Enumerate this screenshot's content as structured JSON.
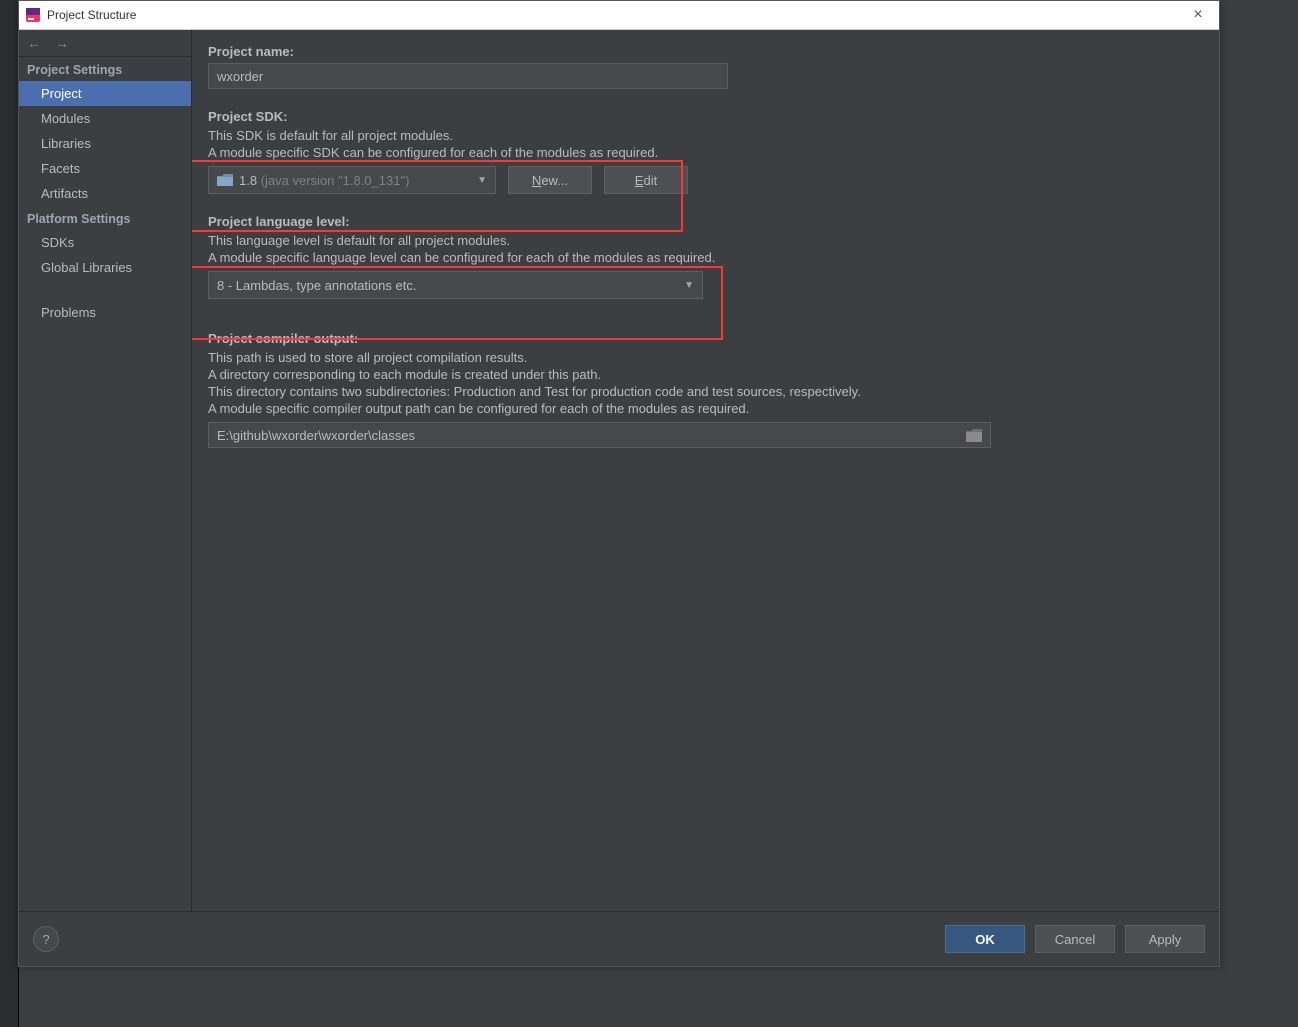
{
  "window": {
    "title": "Project Structure"
  },
  "sidebar": {
    "section1": "Project Settings",
    "items1": [
      "Project",
      "Modules",
      "Libraries",
      "Facets",
      "Artifacts"
    ],
    "section2": "Platform Settings",
    "items2": [
      "SDKs",
      "Global Libraries"
    ],
    "problems": "Problems"
  },
  "project_name": {
    "label": "Project name:",
    "value": "wxorder"
  },
  "project_sdk": {
    "label": "Project SDK:",
    "desc1": "This SDK is default for all project modules.",
    "desc2": "A module specific SDK can be configured for each of the modules as required.",
    "value_main": "1.8",
    "value_dim": "(java version \"1.8.0_131\")",
    "new_btn": "New...",
    "new_mnemonic": "N",
    "edit_btn": "Edit",
    "edit_mnemonic": "E"
  },
  "lang_level": {
    "label": "Project language level:",
    "desc1": "This language level is default for all project modules.",
    "desc2": "A module specific language level can be configured for each of the modules as required.",
    "value": "8 - Lambdas, type annotations etc."
  },
  "compiler_output": {
    "label": "Project compiler output:",
    "desc1": "This path is used to store all project compilation results.",
    "desc2": "A directory corresponding to each module is created under this path.",
    "desc3": "This directory contains two subdirectories: Production and Test for production code and test sources, respectively.",
    "desc4": "A module specific compiler output path can be configured for each of the modules as required.",
    "value": "E:\\github\\wxorder\\wxorder\\classes"
  },
  "footer": {
    "ok": "OK",
    "cancel": "Cancel",
    "apply": "Apply",
    "apply_mnemonic": "A"
  }
}
